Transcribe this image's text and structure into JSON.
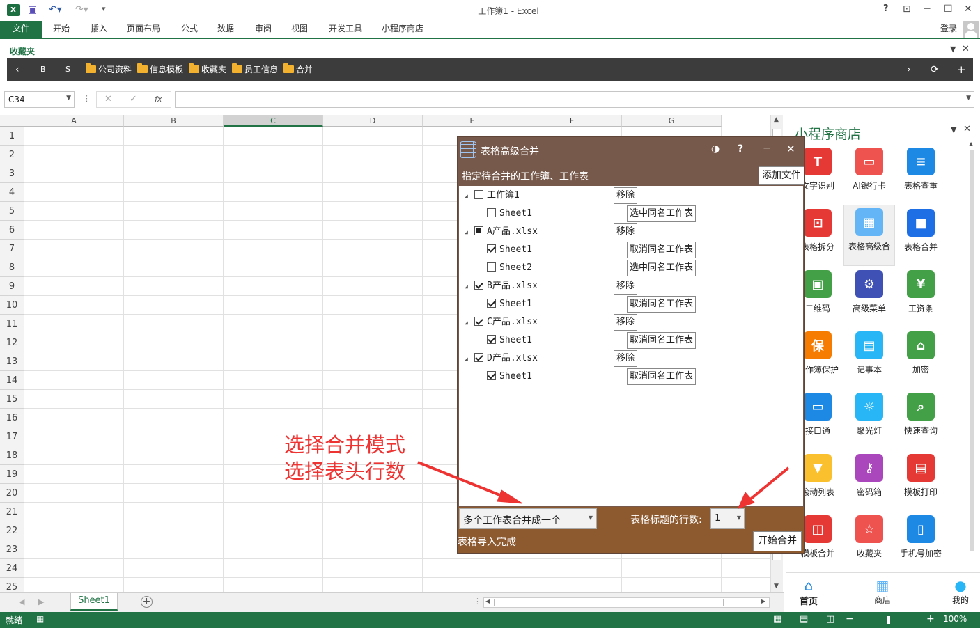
{
  "window": {
    "title": "工作簿1 - Excel",
    "login": "登录"
  },
  "ribbon": {
    "file": "文件",
    "tabs": [
      "开始",
      "插入",
      "页面布局",
      "公式",
      "数据",
      "审阅",
      "视图",
      "开发工具",
      "小程序商店"
    ]
  },
  "favorites": {
    "header": "收藏夹",
    "items": [
      "B",
      "S"
    ],
    "folders": [
      "公司资料",
      "信息模板",
      "收藏夹",
      "员工信息",
      "合并"
    ]
  },
  "formula": {
    "namebox": "C34",
    "fx": "fx"
  },
  "grid": {
    "columns": [
      "A",
      "B",
      "C",
      "D",
      "E",
      "F",
      "G"
    ],
    "rows": [
      "1",
      "2",
      "3",
      "4",
      "5",
      "6",
      "7",
      "8",
      "9",
      "10",
      "11",
      "12",
      "13",
      "14",
      "15",
      "16",
      "17",
      "18",
      "19",
      "20",
      "21",
      "22",
      "23",
      "24",
      "25"
    ]
  },
  "sheets": {
    "active": "Sheet1"
  },
  "status": {
    "ready": "就绪",
    "zoom": "100%"
  },
  "panel": {
    "title": "小程序商店",
    "apps": [
      {
        "label": "文字识别",
        "color": "#e53935",
        "glyph": "T"
      },
      {
        "label": "AI银行卡",
        "color": "#ef5350",
        "glyph": "▭"
      },
      {
        "label": "表格查重",
        "color": "#1e88e5",
        "glyph": "≡"
      },
      {
        "label": "表格拆分",
        "color": "#e53935",
        "glyph": "⊡"
      },
      {
        "label": "表格高级合",
        "color": "#64b5f6",
        "glyph": "▦"
      },
      {
        "label": "表格合并",
        "color": "#1e6fe6",
        "glyph": "■"
      },
      {
        "label": "二维码",
        "color": "#43a047",
        "glyph": "▣"
      },
      {
        "label": "高级菜单",
        "color": "#3f51b5",
        "glyph": "⚙"
      },
      {
        "label": "工资条",
        "color": "#43a047",
        "glyph": "¥"
      },
      {
        "label": "工作簿保护",
        "color": "#f57c00",
        "glyph": "保"
      },
      {
        "label": "记事本",
        "color": "#29b6f6",
        "glyph": "▤"
      },
      {
        "label": "加密",
        "color": "#43a047",
        "glyph": "⌂"
      },
      {
        "label": "接口通",
        "color": "#1e88e5",
        "glyph": "▭"
      },
      {
        "label": "聚光灯",
        "color": "#29b6f6",
        "glyph": "☼"
      },
      {
        "label": "快速查询",
        "color": "#43a047",
        "glyph": "⌕"
      },
      {
        "label": "滚动列表",
        "color": "#fbc02d",
        "glyph": "▼"
      },
      {
        "label": "密码箱",
        "color": "#ab47bc",
        "glyph": "⚷"
      },
      {
        "label": "模板打印",
        "color": "#e53935",
        "glyph": "▤"
      },
      {
        "label": "模板合并",
        "color": "#e53935",
        "glyph": "◫"
      },
      {
        "label": "收藏夹",
        "color": "#ef5350",
        "glyph": "☆"
      },
      {
        "label": "手机号加密",
        "color": "#1e88e5",
        "glyph": "▯"
      }
    ],
    "nav": [
      "首页",
      "商店",
      "我的"
    ]
  },
  "dialog": {
    "title": "表格高级合并",
    "instruction": "指定待合并的工作簿、工作表",
    "add_button": "添加文件",
    "tree": [
      {
        "label": "工作簿1",
        "level": 0,
        "state": "off",
        "button": "移除"
      },
      {
        "label": "Sheet1",
        "level": 1,
        "state": "off",
        "button": "选中同名工作表"
      },
      {
        "label": "A产品.xlsx",
        "level": 0,
        "state": "part",
        "button": "移除"
      },
      {
        "label": "Sheet1",
        "level": 1,
        "state": "on",
        "button": "取消同名工作表"
      },
      {
        "label": "Sheet2",
        "level": 1,
        "state": "off",
        "button": "选中同名工作表"
      },
      {
        "label": "B产品.xlsx",
        "level": 0,
        "state": "on",
        "button": "移除"
      },
      {
        "label": "Sheet1",
        "level": 1,
        "state": "on",
        "button": "取消同名工作表"
      },
      {
        "label": "C产品.xlsx",
        "level": 0,
        "state": "on",
        "button": "移除"
      },
      {
        "label": "Sheet1",
        "level": 1,
        "state": "on",
        "button": "取消同名工作表"
      },
      {
        "label": "D产品.xlsx",
        "level": 0,
        "state": "on",
        "button": "移除"
      },
      {
        "label": "Sheet1",
        "level": 1,
        "state": "on",
        "button": "取消同名工作表"
      }
    ],
    "mode_select": "多个工作表合并成一个",
    "header_rows_label": "表格标题的行数:",
    "header_rows_value": "1",
    "status": "表格导入完成",
    "start_button": "开始合并"
  },
  "annotation": {
    "line1": "选择合并模式",
    "line2": "选择表头行数",
    "color": "#ee3333"
  }
}
